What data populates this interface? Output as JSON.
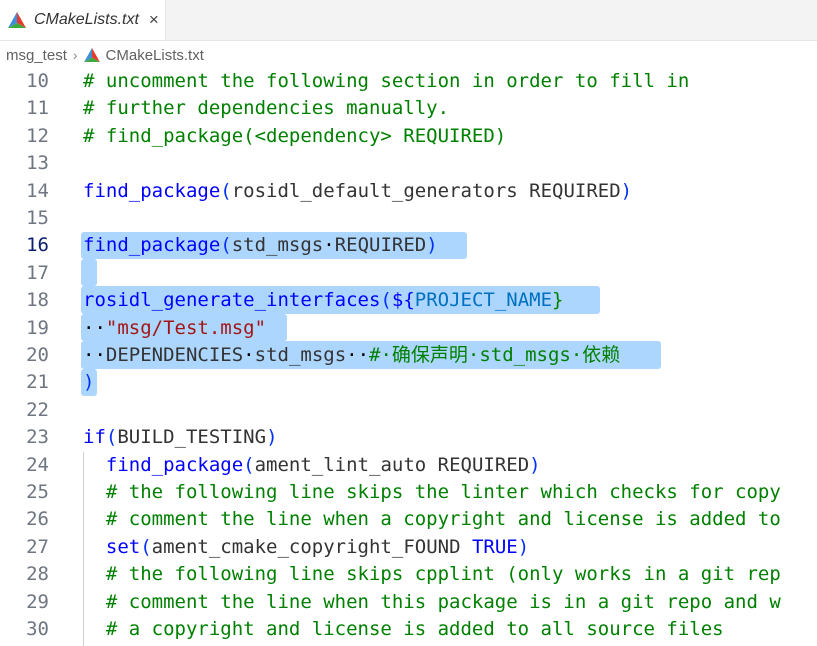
{
  "tab": {
    "label": "CMakeLists.txt",
    "close_glyph": "×",
    "icon": "cmake-icon"
  },
  "breadcrumb": {
    "folder": "msg_test",
    "separator": "›",
    "file": "CMakeLists.txt",
    "icon": "cmake-icon"
  },
  "editor": {
    "active_line": "16",
    "colors": {
      "comment": "#008000",
      "function": "#0000ff",
      "string": "#a31515",
      "selection": "#add6ff"
    },
    "lines": [
      {
        "num": "10",
        "tokens": [
          {
            "t": "# uncomment the following section in order to fill in",
            "c": "cm"
          }
        ]
      },
      {
        "num": "11",
        "tokens": [
          {
            "t": "# further dependencies manually.",
            "c": "cm"
          }
        ]
      },
      {
        "num": "12",
        "tokens": [
          {
            "t": "# find_package(<dependency> REQUIRED)",
            "c": "cm"
          }
        ]
      },
      {
        "num": "13",
        "tokens": []
      },
      {
        "num": "14",
        "tokens": [
          {
            "t": "find_package",
            "c": "fn"
          },
          {
            "t": "(",
            "c": "p"
          },
          {
            "t": "rosidl_default_generators REQUIRED",
            "c": "tx"
          },
          {
            "t": ")",
            "c": "p"
          }
        ]
      },
      {
        "num": "15",
        "tokens": []
      },
      {
        "num": "16",
        "tokens": [
          {
            "t": "find_package",
            "c": "fn"
          },
          {
            "t": "(",
            "c": "p"
          },
          {
            "t": "std_msgs",
            "c": "tx"
          },
          {
            "t": "·",
            "c": "ws"
          },
          {
            "t": "REQUIRED",
            "c": "tx"
          },
          {
            "t": ")",
            "c": "p"
          }
        ]
      },
      {
        "num": "17",
        "tokens": []
      },
      {
        "num": "18",
        "tokens": [
          {
            "t": "rosidl_generate_interfaces",
            "c": "fn"
          },
          {
            "t": "(",
            "c": "p"
          },
          {
            "t": "${",
            "c": "kw"
          },
          {
            "t": "PROJECT_NAME",
            "c": "var"
          },
          {
            "t": "}",
            "c": "cm"
          }
        ]
      },
      {
        "num": "19",
        "tokens": [
          {
            "t": "··",
            "c": "ws"
          },
          {
            "t": "\"msg/Test.msg\"",
            "c": "st"
          }
        ]
      },
      {
        "num": "20",
        "tokens": [
          {
            "t": "··",
            "c": "ws"
          },
          {
            "t": "DEPENDENCIES",
            "c": "tx"
          },
          {
            "t": "·",
            "c": "ws"
          },
          {
            "t": "std_msgs",
            "c": "tx"
          },
          {
            "t": "··",
            "c": "ws"
          },
          {
            "t": "#·确保声明·std_msgs·依赖",
            "c": "cm"
          }
        ]
      },
      {
        "num": "21",
        "tokens": [
          {
            "t": ")",
            "c": "p"
          }
        ]
      },
      {
        "num": "22",
        "tokens": []
      },
      {
        "num": "23",
        "tokens": [
          {
            "t": "if",
            "c": "kw"
          },
          {
            "t": "(",
            "c": "p"
          },
          {
            "t": "BUILD_TESTING",
            "c": "tx"
          },
          {
            "t": ")",
            "c": "p"
          }
        ]
      },
      {
        "num": "24",
        "tokens": [
          {
            "t": "  find_package",
            "c": "fn"
          },
          {
            "t": "(",
            "c": "p"
          },
          {
            "t": "ament_lint_auto REQUIRED",
            "c": "tx"
          },
          {
            "t": ")",
            "c": "p"
          }
        ]
      },
      {
        "num": "25",
        "tokens": [
          {
            "t": "  # the following line skips the linter which checks for copy",
            "c": "cm"
          }
        ]
      },
      {
        "num": "26",
        "tokens": [
          {
            "t": "  # comment the line when a copyright and license is added to",
            "c": "cm"
          }
        ]
      },
      {
        "num": "27",
        "tokens": [
          {
            "t": "  set",
            "c": "kw"
          },
          {
            "t": "(",
            "c": "p"
          },
          {
            "t": "ament_cmake_copyright_FOUND ",
            "c": "tx"
          },
          {
            "t": "TRUE",
            "c": "kw"
          },
          {
            "t": ")",
            "c": "p"
          }
        ]
      },
      {
        "num": "28",
        "tokens": [
          {
            "t": "  # the following line skips cpplint (only works in a git rep",
            "c": "cm"
          }
        ]
      },
      {
        "num": "29",
        "tokens": [
          {
            "t": "  # comment the line when this package is in a git repo and w",
            "c": "cm"
          }
        ]
      },
      {
        "num": "30",
        "tokens": [
          {
            "t": "  # a copyright and license is added to all source files",
            "c": "cm"
          }
        ]
      }
    ]
  }
}
